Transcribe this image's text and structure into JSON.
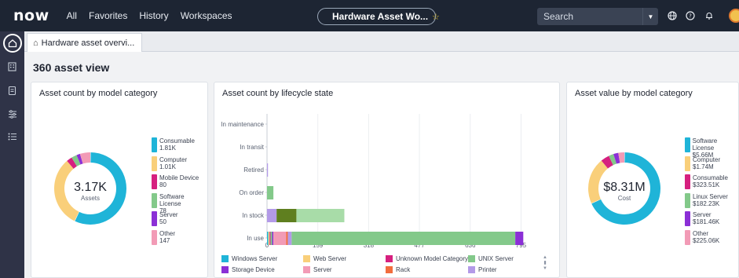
{
  "nav": {
    "logo": "now",
    "links": [
      "All",
      "Favorites",
      "History",
      "Workspaces"
    ],
    "context_title": "Hardware Asset Wo...",
    "search_placeholder": "Search"
  },
  "tabs": [
    {
      "label": "Hardware asset overvi..."
    }
  ],
  "page_title": "360 asset view",
  "cards": {
    "count_by_category": {
      "title": "Asset count by model category",
      "center_value": "3.17K",
      "center_label": "Assets",
      "legend": [
        {
          "name": "Consumable",
          "value": "1.81K",
          "color": "#1fb4d8"
        },
        {
          "name": "Computer",
          "value": "1.01K",
          "color": "#f9cf7a"
        },
        {
          "name": "Mobile Device",
          "value": "80",
          "color": "#d6207f"
        },
        {
          "name": "Software License",
          "value": "78",
          "color": "#83c98a"
        },
        {
          "name": "Server",
          "value": "50",
          "color": "#8b2fd6"
        },
        {
          "name": "Other",
          "value": "147",
          "color": "#f29bb6"
        }
      ],
      "slices": [
        1810,
        1010,
        80,
        78,
        50,
        147
      ]
    },
    "lifecycle": {
      "title": "Asset count by lifecycle state",
      "states": [
        "In maintenance",
        "In transit",
        "Retired",
        "On order",
        "In stock",
        "In use"
      ],
      "x_ticks": [
        "0",
        "159",
        "318",
        "477",
        "636",
        "795"
      ],
      "x_max": 795,
      "legend": [
        {
          "name": "Windows Server",
          "color": "#1fb4d8"
        },
        {
          "name": "Web Server",
          "color": "#f9cf7a"
        },
        {
          "name": "Unknown Model Category",
          "color": "#d6207f"
        },
        {
          "name": "UNIX Server",
          "color": "#83c98a"
        },
        {
          "name": "Storage Device",
          "color": "#8b2fd6"
        },
        {
          "name": "Server",
          "color": "#f29bb6"
        },
        {
          "name": "Rack",
          "color": "#f26d3d"
        },
        {
          "name": "Printer",
          "color": "#b39ae8"
        }
      ]
    },
    "value_by_category": {
      "title": "Asset value by model category",
      "center_value": "$8.31M",
      "center_label": "Cost",
      "legend": [
        {
          "name": "Software License",
          "value": "$5.66M",
          "color": "#1fb4d8"
        },
        {
          "name": "Computer",
          "value": "$1.74M",
          "color": "#f9cf7a"
        },
        {
          "name": "Consumable",
          "value": "$323.51K",
          "color": "#d6207f"
        },
        {
          "name": "Linux Server",
          "value": "$182.23K",
          "color": "#83c98a"
        },
        {
          "name": "Server",
          "value": "$181.46K",
          "color": "#8b2fd6"
        },
        {
          "name": "Other",
          "value": "$225.06K",
          "color": "#f29bb6"
        }
      ],
      "slices": [
        5660,
        1740,
        323.51,
        182.23,
        181.46,
        225.06
      ]
    }
  }
}
